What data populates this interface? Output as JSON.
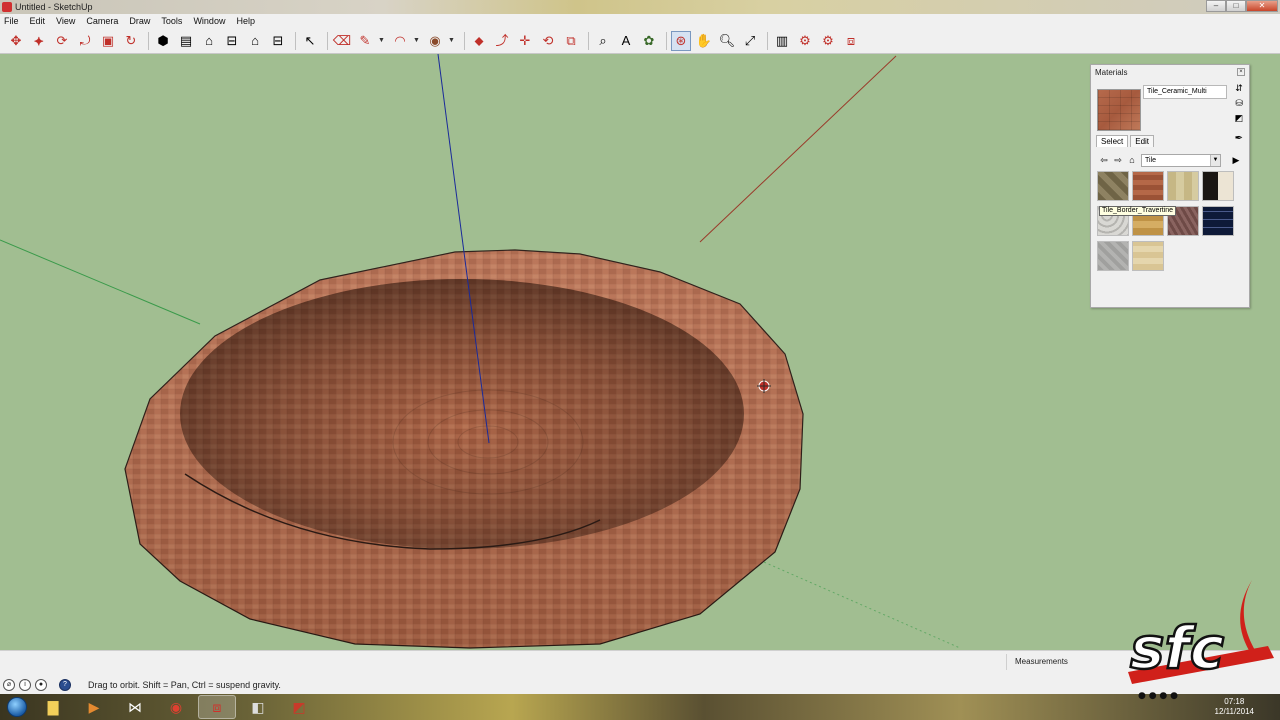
{
  "window": {
    "title": "Untitled - SketchUp",
    "buttons": [
      "minimize",
      "maximize",
      "close"
    ]
  },
  "menu": [
    "File",
    "Edit",
    "View",
    "Camera",
    "Draw",
    "Tools",
    "Window",
    "Help"
  ],
  "toolbar": {
    "groups": [
      [
        "move-arrows-icon",
        "scale-icon",
        "rotate-icon",
        "follow-me-icon",
        "push-pull-icon",
        "offset-icon"
      ],
      [
        "iso-view-icon",
        "top-view-icon",
        "front-view-icon",
        "right-view-icon",
        "back-view-icon",
        "left-view-icon"
      ],
      [
        "select-arrow-icon"
      ],
      [
        "eraser-icon",
        "pencil-line-icon",
        "arc-icon",
        "circle-icon"
      ],
      [
        "move-icon",
        "push-pull-2-icon",
        "move-cross-icon",
        "rotate-2-icon",
        "scale-2-icon"
      ],
      [
        "tape-measure-icon",
        "text-icon",
        "paint-bucket-icon"
      ],
      [
        "orbit-icon",
        "pan-icon",
        "zoom-icon",
        "zoom-extents-icon"
      ],
      [
        "warehouse-icon",
        "extension-icon",
        "share-model-icon",
        "layout-icon"
      ]
    ],
    "active_tool": "orbit-icon"
  },
  "materials": {
    "panel_title": "Materials",
    "current_material": "Tile_Ceramic_Multi",
    "tabs": [
      "Select",
      "Edit"
    ],
    "selected_tab": "Select",
    "collection": "Tile",
    "swatches": [
      "#7f7355",
      "#a65a3c",
      "#cfc192",
      "#2a2520",
      "#c9c8c4",
      "#c99d50",
      "#6e4a46",
      "#0e1a38",
      "#a7a7a5",
      "#ddc99a"
    ],
    "tooltip": "Tile_Border_Travertine"
  },
  "status": {
    "hint": "Drag to orbit. Shift = Pan, Ctrl = suspend gravity.",
    "measurements_label": "Measurements",
    "icons": [
      "georef-icon",
      "credits-icon",
      "user-icon",
      "help-icon"
    ]
  },
  "taskbar": {
    "apps": [
      "explorer-icon",
      "media-icon",
      "visual-studio-icon",
      "chrome-icon",
      "sketchup-icon",
      "sketchup-2-icon",
      "layout-2-icon"
    ],
    "time": "07:18",
    "date": "12/11/2014"
  },
  "watermark": "sfc",
  "colors": {
    "viewport_bg": "#a1be91",
    "bowl": "#b0684a",
    "bowl_dark": "#7a4a33",
    "axis_blue": "#1a2a9a",
    "axis_red": "#9a3a2a",
    "axis_green": "#3a9a4a"
  }
}
